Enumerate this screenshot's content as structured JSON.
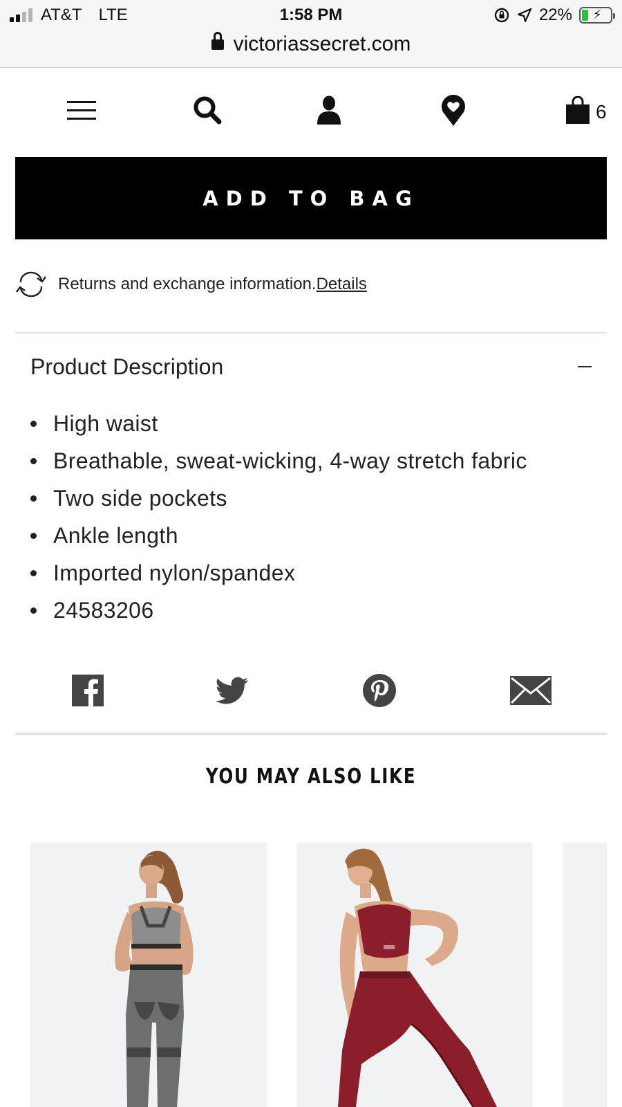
{
  "status_bar": {
    "carrier": "AT&T",
    "network": "LTE",
    "time": "1:58 PM",
    "battery_percent": "22%",
    "signal_bars_active": 2,
    "battery_fill_fraction": 0.22
  },
  "browser": {
    "url": "victoriassecret.com"
  },
  "nav": {
    "icons": [
      "menu-icon",
      "search-icon",
      "account-icon",
      "wishlist-heart-icon",
      "shopping-bag-icon"
    ],
    "cart_count": "6"
  },
  "add_to_bag_label": "ADD TO BAG",
  "returns": {
    "text": "Returns and exchange information.",
    "link": "Details"
  },
  "product_description": {
    "title": "Product Description",
    "toggle_icon": "minus-icon",
    "items": [
      "High waist",
      "Breathable, sweat-wicking, 4-way stretch fabric",
      "Two side pockets",
      "Ankle length",
      "Imported nylon/spandex",
      "24583206"
    ]
  },
  "share": {
    "icons": [
      "facebook-icon",
      "twitter-icon",
      "pinterest-icon",
      "email-icon"
    ]
  },
  "you_may_also_like": {
    "title": "YOU MAY ALSO LIKE",
    "products": [
      {
        "image": "model-gray-seamless-leggings-and-sports-bra"
      },
      {
        "image": "model-burgundy-seamless-leggings-and-sports-bra"
      }
    ]
  },
  "colors": {
    "button_bg": "#000000",
    "button_text": "#ffffff",
    "card_bg": "#f1f2f4",
    "legging_gray": "#6e6e6e",
    "legging_burgundy": "#8b1e2a"
  }
}
